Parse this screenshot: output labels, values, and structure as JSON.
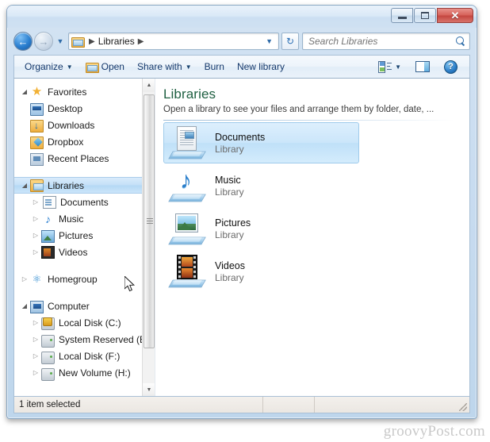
{
  "window": {
    "titlebar": {
      "minimize_label": "–",
      "maximize_label": "",
      "close_label": "✕"
    }
  },
  "addressbar": {
    "back_glyph": "←",
    "forward_glyph": "→",
    "recent_arrow": "▼",
    "crumb_root": "Libraries",
    "crumb_sep": "▶",
    "path_dropdown": "▼",
    "refresh_glyph": "↻"
  },
  "search": {
    "placeholder": "Search Libraries",
    "value": ""
  },
  "toolbar": {
    "organize": "Organize",
    "open": "Open",
    "share_with": "Share with",
    "burn": "Burn",
    "new_library": "New library",
    "caret": "▼",
    "help_label": "?"
  },
  "navpane": {
    "scroll_up": "▲",
    "scroll_down": "▼",
    "groups": [
      {
        "label": "Favorites",
        "twisty": "◢",
        "icon": "star-icon",
        "children": [
          {
            "label": "Desktop",
            "icon": "desktop-icon"
          },
          {
            "label": "Downloads",
            "icon": "downloads-icon"
          },
          {
            "label": "Dropbox",
            "icon": "dropbox-icon"
          },
          {
            "label": "Recent Places",
            "icon": "recent-places-icon"
          }
        ]
      },
      {
        "label": "Libraries",
        "twisty": "◢",
        "icon": "libraries-icon",
        "selected": true,
        "children": [
          {
            "label": "Documents",
            "icon": "documents-icon",
            "twisty": "▷"
          },
          {
            "label": "Music",
            "icon": "music-icon",
            "twisty": "▷"
          },
          {
            "label": "Pictures",
            "icon": "pictures-icon",
            "twisty": "▷"
          },
          {
            "label": "Videos",
            "icon": "videos-icon",
            "twisty": "▷"
          }
        ]
      },
      {
        "label": "Homegroup",
        "twisty": "▷",
        "icon": "homegroup-icon",
        "children": []
      },
      {
        "label": "Computer",
        "twisty": "◢",
        "icon": "computer-icon",
        "children": [
          {
            "label": "Local Disk (C:)",
            "icon": "system-drive-icon",
            "twisty": "▷"
          },
          {
            "label": "System Reserved (E:",
            "icon": "drive-icon",
            "twisty": "▷"
          },
          {
            "label": "Local Disk (F:)",
            "icon": "drive-icon",
            "twisty": "▷"
          },
          {
            "label": "New Volume (H:)",
            "icon": "drive-icon",
            "twisty": "▷"
          }
        ]
      }
    ]
  },
  "main": {
    "title": "Libraries",
    "subtitle": "Open a library to see your files and arrange them by folder, date, ...",
    "items": [
      {
        "name": "Documents",
        "type": "Library",
        "icon": "documents-library-icon",
        "selected": true
      },
      {
        "name": "Music",
        "type": "Library",
        "icon": "music-library-icon",
        "selected": false
      },
      {
        "name": "Pictures",
        "type": "Library",
        "icon": "pictures-library-icon",
        "selected": false
      },
      {
        "name": "Videos",
        "type": "Library",
        "icon": "videos-library-icon",
        "selected": false
      }
    ]
  },
  "statusbar": {
    "text": "1 item selected"
  },
  "watermark": {
    "text": "groovyPost.com"
  },
  "colors": {
    "title_green": "#1f6042",
    "selection_blue": "#cbe6fa",
    "close_red": "#c44740",
    "accent_blue": "#2a7fd0"
  }
}
